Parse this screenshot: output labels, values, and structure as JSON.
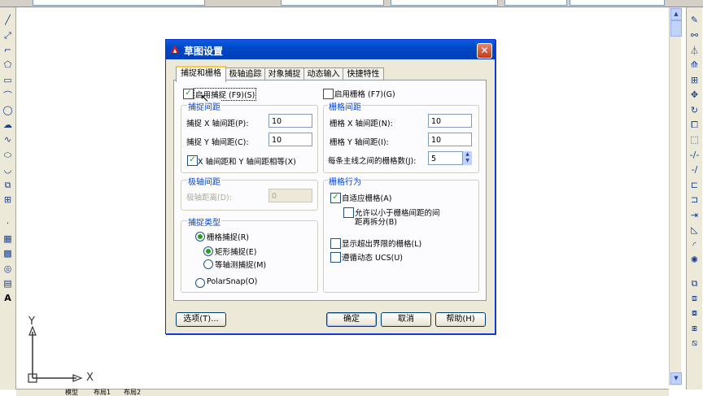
{
  "dialog": {
    "title": "草图设置",
    "close_icon": "close-icon",
    "tabs": [
      "捕捉和栅格",
      "极轴追踪",
      "对象捕捉",
      "动态输入",
      "快捷特性"
    ],
    "active_tab": 0
  },
  "snap": {
    "enable_label": "启用捕捉 (F9)(S)",
    "enabled": true,
    "spacing_group": "捕捉间距",
    "x_label": "捕捉 X 轴间距(P):",
    "x_value": "10",
    "y_label": "捕捉 Y 轴间距(C):",
    "y_value": "10",
    "equal_label": "X 轴间距和 Y 轴间距相等(X)",
    "equal_checked": true
  },
  "polar": {
    "group": "极轴间距",
    "distance_label": "极轴距离(D):",
    "distance_value": "0"
  },
  "snap_type": {
    "group": "捕捉类型",
    "grid_snap": "栅格捕捉(R)",
    "rect_snap": "矩形捕捉(E)",
    "iso_snap": "等轴测捕捉(M)",
    "polar_snap": "PolarSnap(O)",
    "selected": "rect_snap"
  },
  "grid": {
    "enable_label": "启用栅格 (F7)(G)",
    "enabled": false,
    "spacing_group": "栅格间距",
    "x_label": "栅格 X 轴间距(N):",
    "x_value": "10",
    "y_label": "栅格 Y 轴间距(I):",
    "y_value": "10",
    "major_label": "每条主线之间的栅格数(J):",
    "major_value": "5"
  },
  "grid_behavior": {
    "group": "栅格行为",
    "adaptive_label": "自适应栅格(A)",
    "adaptive_checked": true,
    "subdiv_line1": "允许以小于栅格间距的间",
    "subdiv_line2": "距再拆分(B)",
    "subdiv_checked": false,
    "beyond_label": "显示超出界限的栅格(L)",
    "beyond_checked": false,
    "dynucs_label": "遵循动态 UCS(U)",
    "dynucs_checked": false
  },
  "buttons": {
    "options": "选项(T)...",
    "ok": "确定",
    "cancel": "取消",
    "help": "帮助(H)"
  },
  "ucs": {
    "y_label": "Y",
    "x_label": "X"
  },
  "bottom_tabs": [
    "模型",
    "布局1",
    "布局2"
  ],
  "left_toolbar_icons": [
    "line-icon",
    "construction-line-icon",
    "polyline-icon",
    "polygon-icon",
    "rectangle-icon",
    "arc-icon",
    "circle-icon",
    "revision-cloud-icon",
    "spline-icon",
    "ellipse-icon",
    "ellipse-arc-icon",
    "insert-block-icon",
    "make-block-icon",
    "point-icon",
    "hatch-icon",
    "gradient-icon",
    "region-icon",
    "table-icon",
    "multiline-text-icon"
  ],
  "right_toolbar_icons": [
    "erase-icon",
    "copy-icon",
    "mirror-icon",
    "offset-icon",
    "array-icon",
    "move-icon",
    "rotate-icon",
    "scale-icon",
    "stretch-icon",
    "trim-icon",
    "extend-icon",
    "break-at-point-icon",
    "break-icon",
    "join-icon",
    "chamfer-icon",
    "fillet-icon",
    "explode-icon",
    "draworder-icon",
    "bring-front-icon",
    "send-back-icon",
    "bring-above-icon",
    "send-under-icon"
  ]
}
